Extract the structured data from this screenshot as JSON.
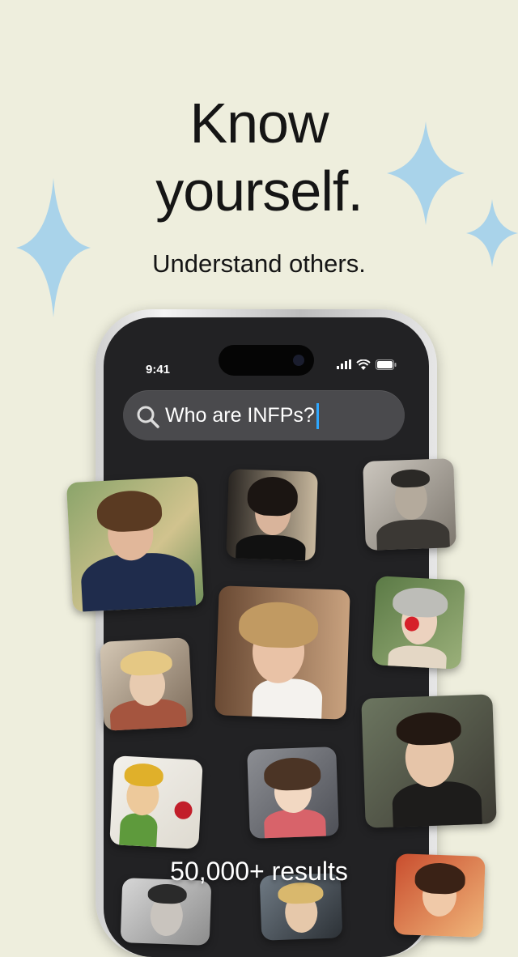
{
  "headline": {
    "line1": "Know",
    "line2": "yourself.",
    "subtitle": "Understand others."
  },
  "phone": {
    "time": "9:41",
    "status_icons": [
      "signal-icon",
      "wifi-icon",
      "battery-icon"
    ]
  },
  "search": {
    "query": "Who are INFPs?",
    "icon": "search-icon"
  },
  "results": {
    "count_label": "50,000+ results"
  },
  "colors": {
    "background": "#eeeedd",
    "sparkle": "#a9d3ea",
    "caret": "#2ea7ff",
    "phone_screen": "#222224"
  }
}
